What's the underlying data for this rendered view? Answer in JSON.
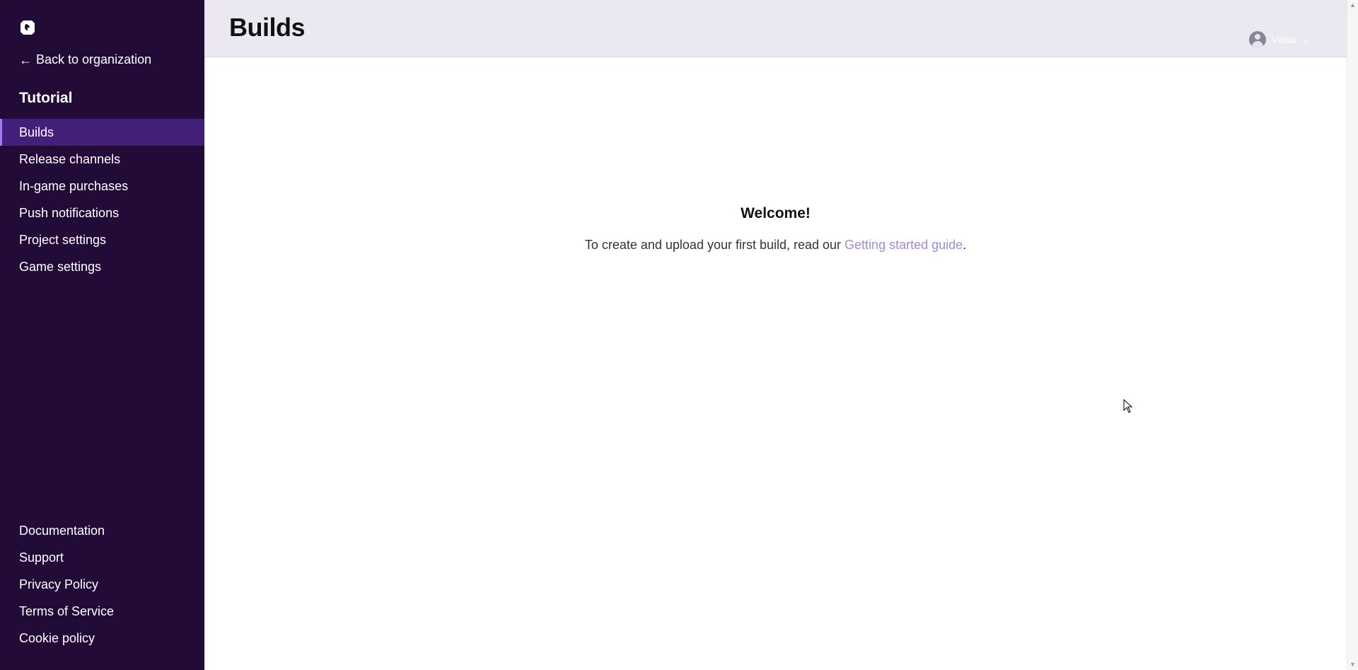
{
  "sidebar": {
    "logo_icon": "game-platform-logo-icon",
    "back_label": "Back to organization",
    "project_title": "Tutorial",
    "items": [
      {
        "label": "Builds",
        "active": true
      },
      {
        "label": "Release channels",
        "active": false
      },
      {
        "label": "In-game purchases",
        "active": false
      },
      {
        "label": "Push notifications",
        "active": false
      },
      {
        "label": "Project settings",
        "active": false
      },
      {
        "label": "Game settings",
        "active": false
      }
    ],
    "footer": [
      {
        "label": "Documentation"
      },
      {
        "label": "Support"
      },
      {
        "label": "Privacy Policy"
      },
      {
        "label": "Terms of Service"
      },
      {
        "label": "Cookie policy"
      }
    ]
  },
  "header": {
    "title": "Builds",
    "user": {
      "name": "Valtar",
      "avatar_icon": "user-avatar-icon"
    }
  },
  "main": {
    "welcome_title": "Welcome!",
    "welcome_prefix": "To create and upload your first build, read our ",
    "guide_link": "Getting started guide",
    "welcome_suffix": "."
  },
  "colors": {
    "sidebar_bg": "#230b38",
    "active_item_bg": "#42207a",
    "active_border": "#a07cf0",
    "header_bg": "#ebe8f2",
    "link": "#a28ae0"
  }
}
